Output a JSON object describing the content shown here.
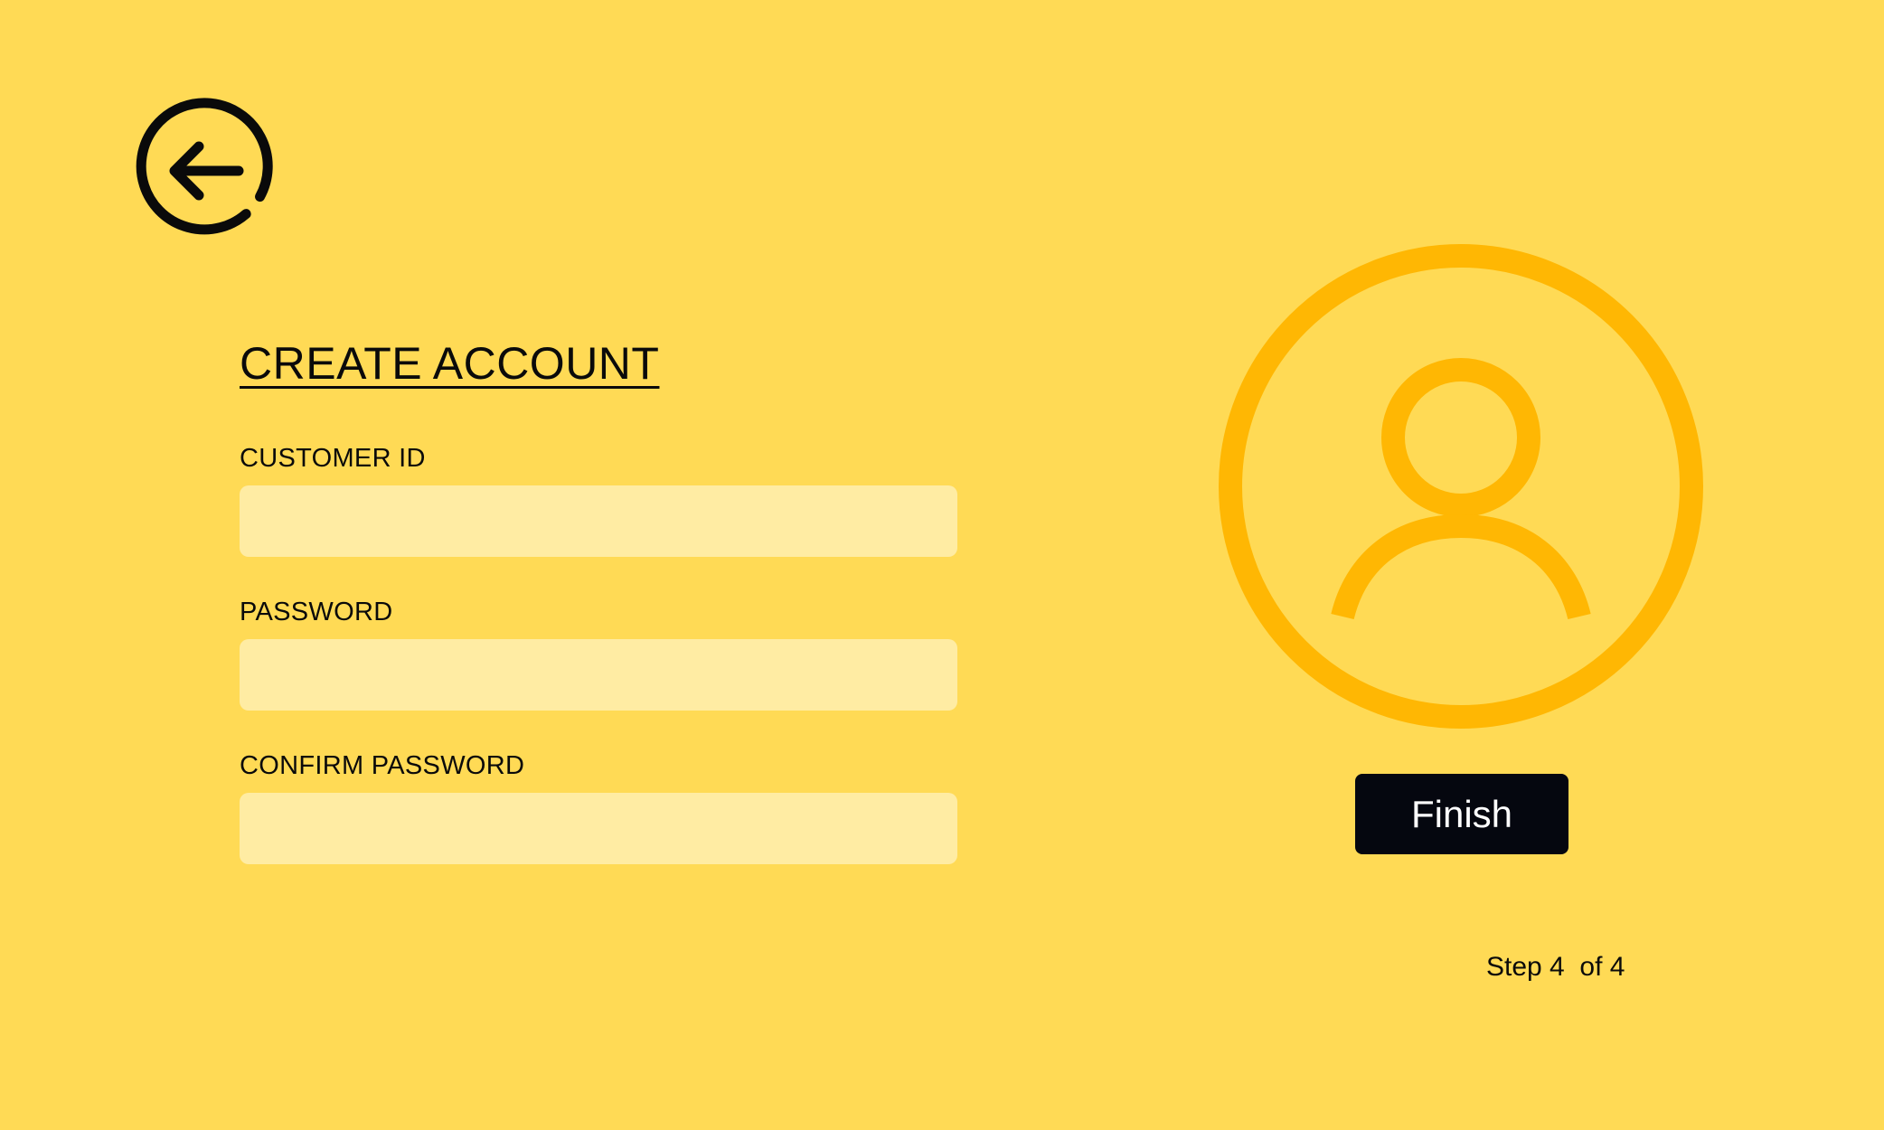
{
  "navigation": {
    "back_icon": "arrow-left-circle-icon"
  },
  "form": {
    "title": "CREATE ACCOUNT",
    "fields": [
      {
        "label": "CUSTOMER ID",
        "value": "",
        "placeholder": ""
      },
      {
        "label": "PASSWORD",
        "value": "",
        "placeholder": ""
      },
      {
        "label": "CONFIRM PASSWORD",
        "value": "",
        "placeholder": ""
      }
    ]
  },
  "profile": {
    "avatar_icon": "user-circle-icon"
  },
  "actions": {
    "finish_label": "Finish"
  },
  "progress": {
    "text": "Step 4  of 4",
    "current_step": 4,
    "total_steps": 4
  },
  "colors": {
    "background": "#FFDA55",
    "input_fill": "#FFECA3",
    "avatar_accent": "#FFB703",
    "button_fill": "#05070F",
    "button_text": "#FFFFFF",
    "text": "#0A0A0A"
  }
}
